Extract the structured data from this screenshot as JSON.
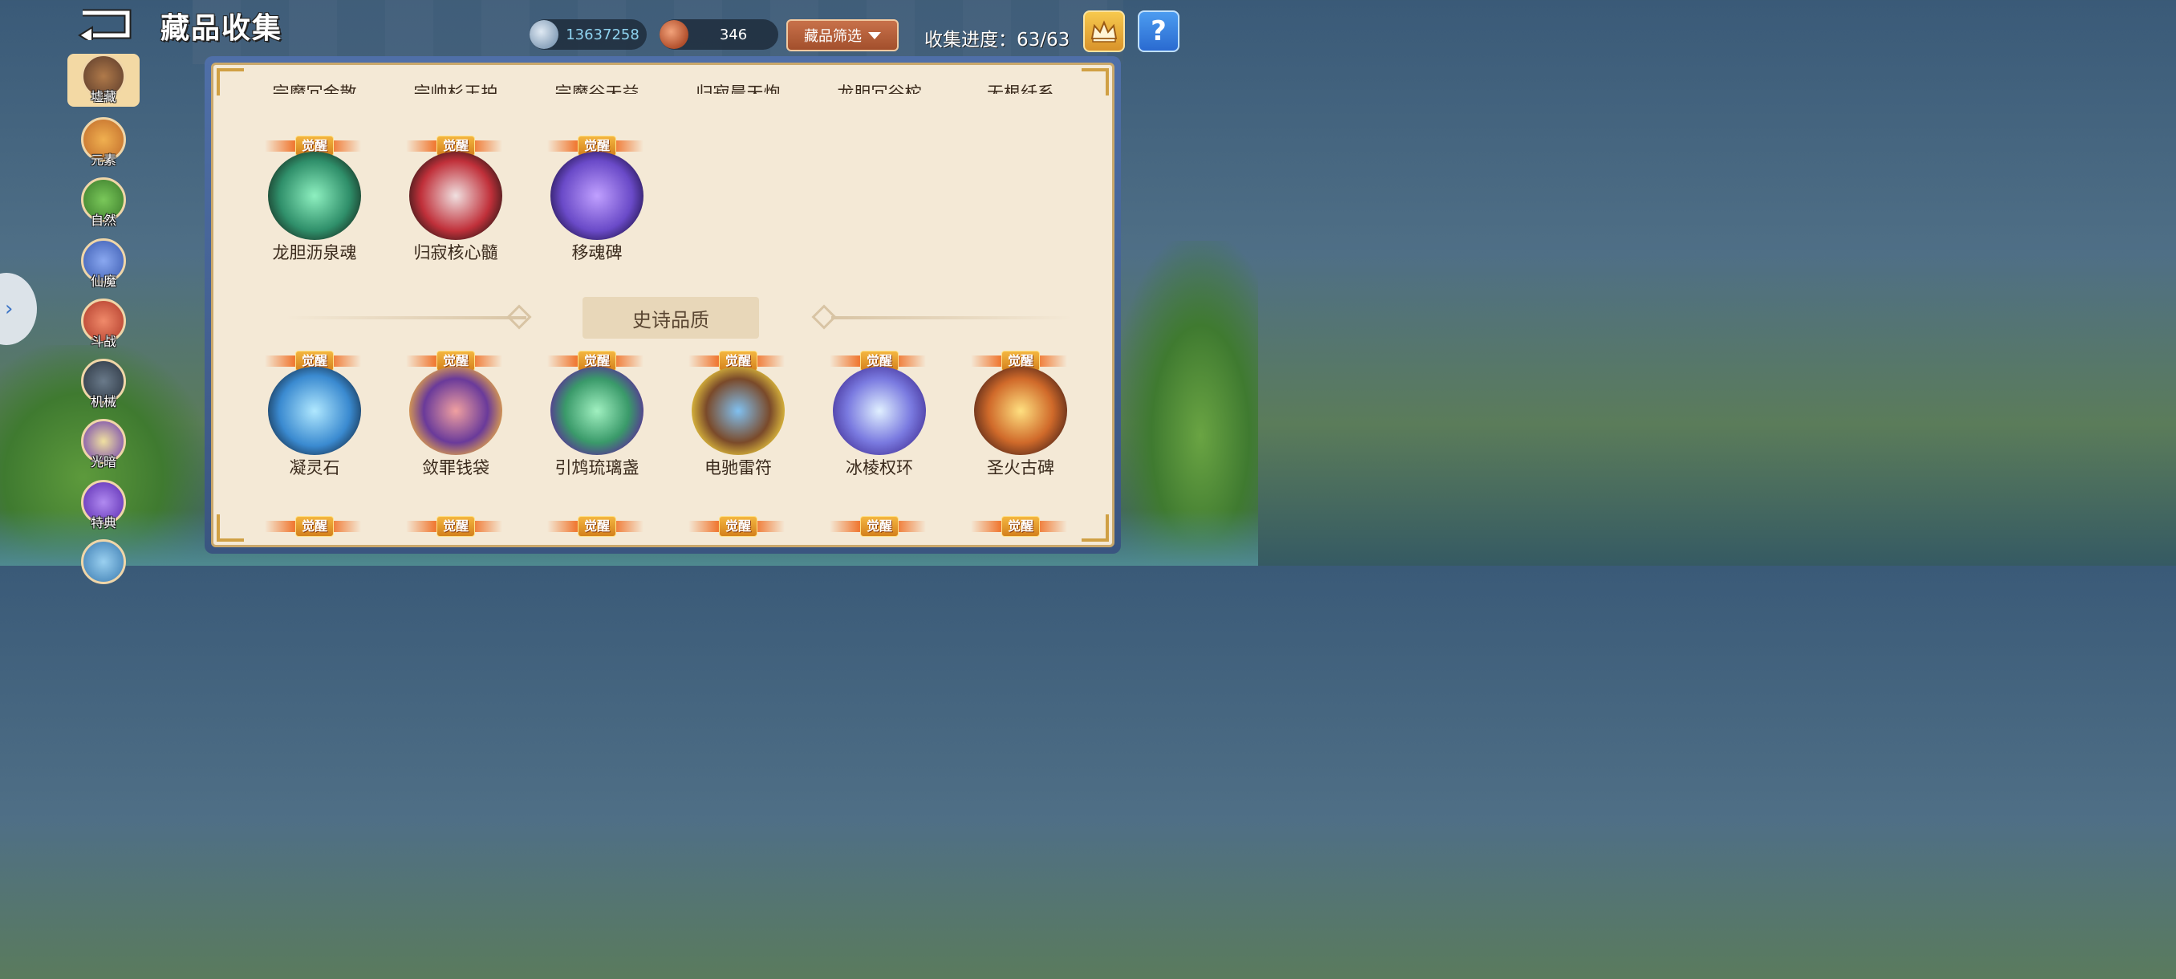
{
  "header": {
    "title": "藏品收集",
    "silver_value": "13637258",
    "gem_value": "346",
    "filter_label": "藏品筛选",
    "progress_text": "收集进度：63/63",
    "help_label": "?"
  },
  "sidebar": {
    "tabs": [
      {
        "label": "墟藏",
        "color": "#8a5a3a"
      },
      {
        "label": "元素",
        "color": "#d0803a"
      },
      {
        "label": "自然",
        "color": "#4f9a3a"
      },
      {
        "label": "仙魔",
        "color": "#5a78c8"
      },
      {
        "label": "斗战",
        "color": "#c84a3a"
      },
      {
        "label": "机械",
        "color": "#3a4a5a"
      },
      {
        "label": "光暗",
        "color": "#8a5ac8"
      },
      {
        "label": "特典",
        "color": "#7a4ac8"
      }
    ]
  },
  "panel": {
    "top_row_names": [
      "宗魔冗金散",
      "宗帅杉玉拍",
      "宗魔谷天益",
      "归寂晨天炮",
      "龙胆冗谷柁",
      "无根纤系"
    ],
    "awaken_label": "觉醒",
    "row1": [
      {
        "name": "龙胆沥泉魂",
        "color": "#2f8f6a"
      },
      {
        "name": "归寂核心髓",
        "color": "#c0303a"
      },
      {
        "name": "移魂碑",
        "color": "#6a4ac8"
      }
    ],
    "section_title": "史诗品质",
    "row2": [
      {
        "name": "凝灵石",
        "color": "#3a8ad0"
      },
      {
        "name": "敛罪钱袋",
        "color": "#6a3a9a"
      },
      {
        "name": "引鸩琉璃盏",
        "color": "#3a9a6a"
      },
      {
        "name": "电驰雷符",
        "color": "#7a4a2a"
      },
      {
        "name": "冰棱权环",
        "color": "#7a7ae0"
      },
      {
        "name": "圣火古碑",
        "color": "#d06a2a"
      }
    ]
  }
}
